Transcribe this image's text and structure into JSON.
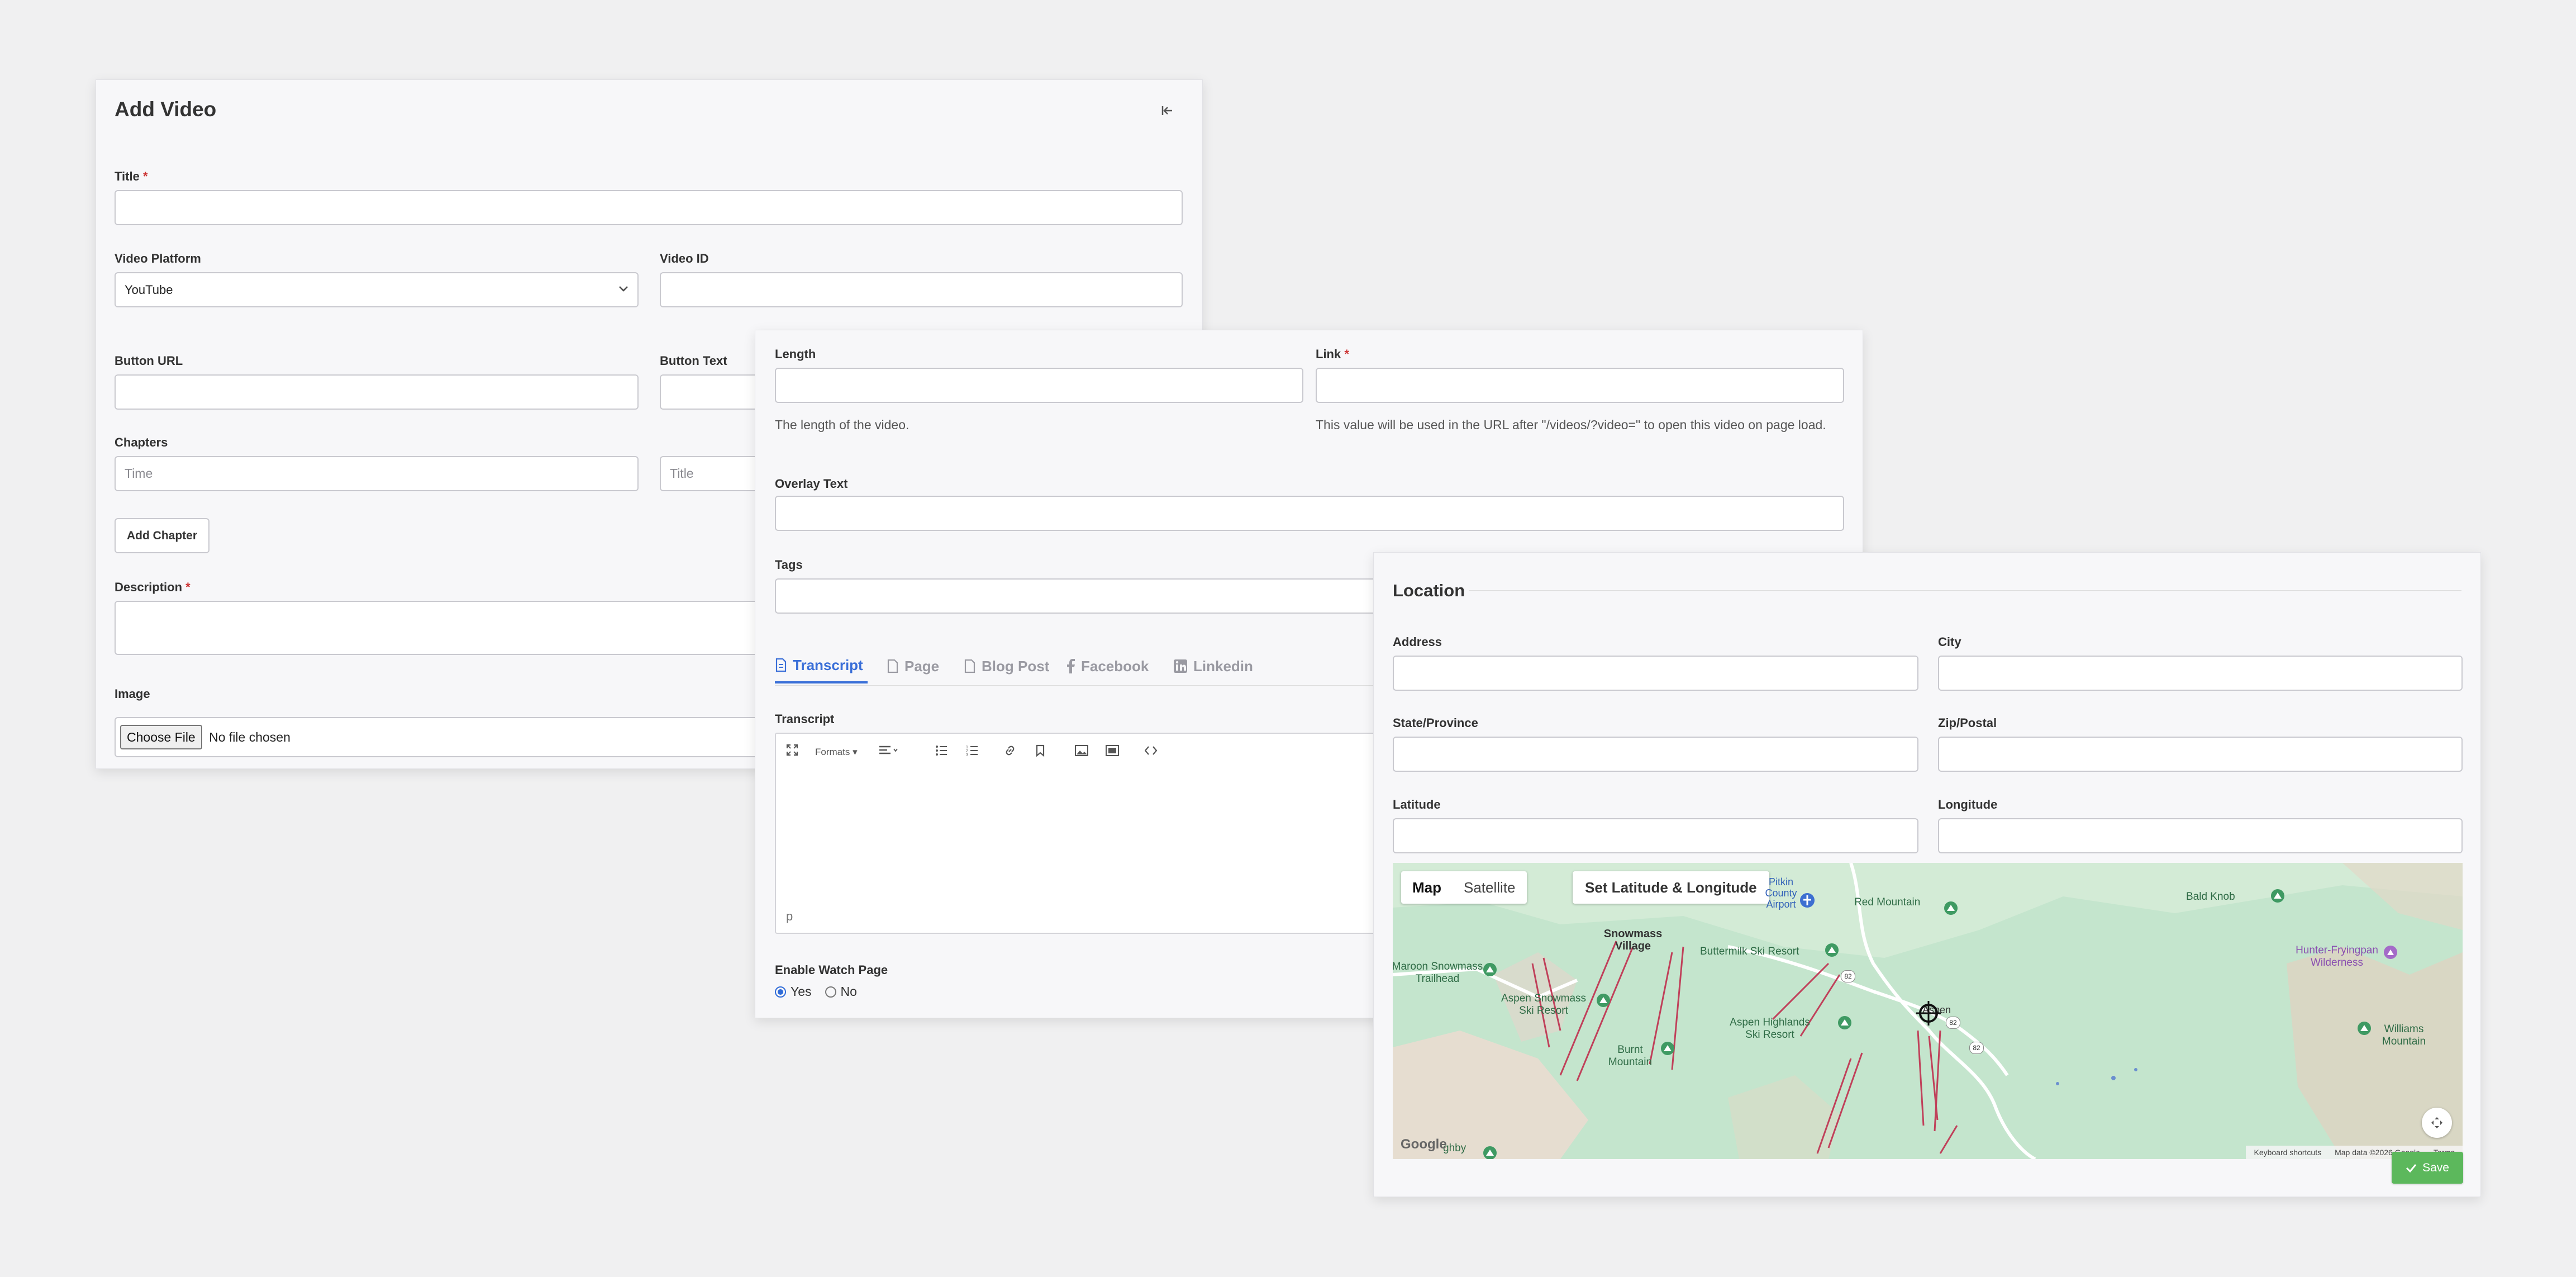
{
  "add_video": {
    "title": "Add Video",
    "title_label": "Title",
    "title_required": "*",
    "platform_label": "Video Platform",
    "platform_value": "YouTube",
    "video_id_label": "Video ID",
    "button_url_label": "Button URL",
    "button_text_label": "Button Text",
    "chapters_label": "Chapters",
    "chapter_time_placeholder": "Time",
    "chapter_title_placeholder": "Title",
    "add_chapter": "Add Chapter",
    "description_label": "Description",
    "description_required": "*",
    "image_label": "Image",
    "choose_file": "Choose File",
    "no_file": "No file chosen"
  },
  "details": {
    "length_label": "Length",
    "length_help": "The length of the video.",
    "link_label": "Link",
    "link_required": "*",
    "link_help": "This value will be used in the URL after \"/videos/?video=\" to open this video on page load.",
    "overlay_label": "Overlay Text",
    "tags_label": "Tags",
    "tabs": [
      {
        "label": "Transcript",
        "icon": "document-icon"
      },
      {
        "label": "Page",
        "icon": "page-icon"
      },
      {
        "label": "Blog Post",
        "icon": "page-icon"
      },
      {
        "label": "Facebook",
        "icon": "facebook-icon"
      },
      {
        "label": "Linkedin",
        "icon": "linkedin-icon"
      }
    ],
    "transcript_label": "Transcript",
    "formats": "Formats",
    "editor_status": "p",
    "watch_label": "Enable Watch Page",
    "watch_yes": "Yes",
    "watch_no": "No",
    "watch_selected": "Yes"
  },
  "location": {
    "title": "Location",
    "address_label": "Address",
    "city_label": "City",
    "state_label": "State/Province",
    "zip_label": "Zip/Postal",
    "lat_label": "Latitude",
    "lng_label": "Longitude",
    "map_btn": "Map",
    "satellite_btn": "Satellite",
    "set_latlng": "Set Latitude & Longitude",
    "places": {
      "pitkin": "Pitkin County Airport",
      "red_mountain": "Red Mountain",
      "bald_knob": "Bald Knob",
      "snowmass_village": "Snowmass Village",
      "buttermilk": "Buttermilk Ski Resort",
      "maroon_trailhead": "Maroon Snowmass Trailhead",
      "aspen_snowmass": "Aspen Snowmass Ski Resort",
      "hunter_frying": "Hunter-Fryingpan Wilderness",
      "aspen_highlands": "Aspen Highlands Ski Resort",
      "burnt_mountain": "Burnt Mountain",
      "aspen": "Aspen",
      "williams_mountain": "Williams Mountain",
      "hwy_82a": "82",
      "hwy_82b": "82",
      "hwy_82c": "82",
      "highlands_bottom": "ghby"
    },
    "google": "Google",
    "keyboard_shortcuts": "Keyboard shortcuts",
    "map_data": "Map data ©2026 Google",
    "terms": "Terms",
    "save": "Save",
    "colors": {
      "save_green": "#5cb85c",
      "map_green": "#bfe3c9",
      "water_blue": "#7d9fd6",
      "lift_red": "#c0405a"
    }
  }
}
